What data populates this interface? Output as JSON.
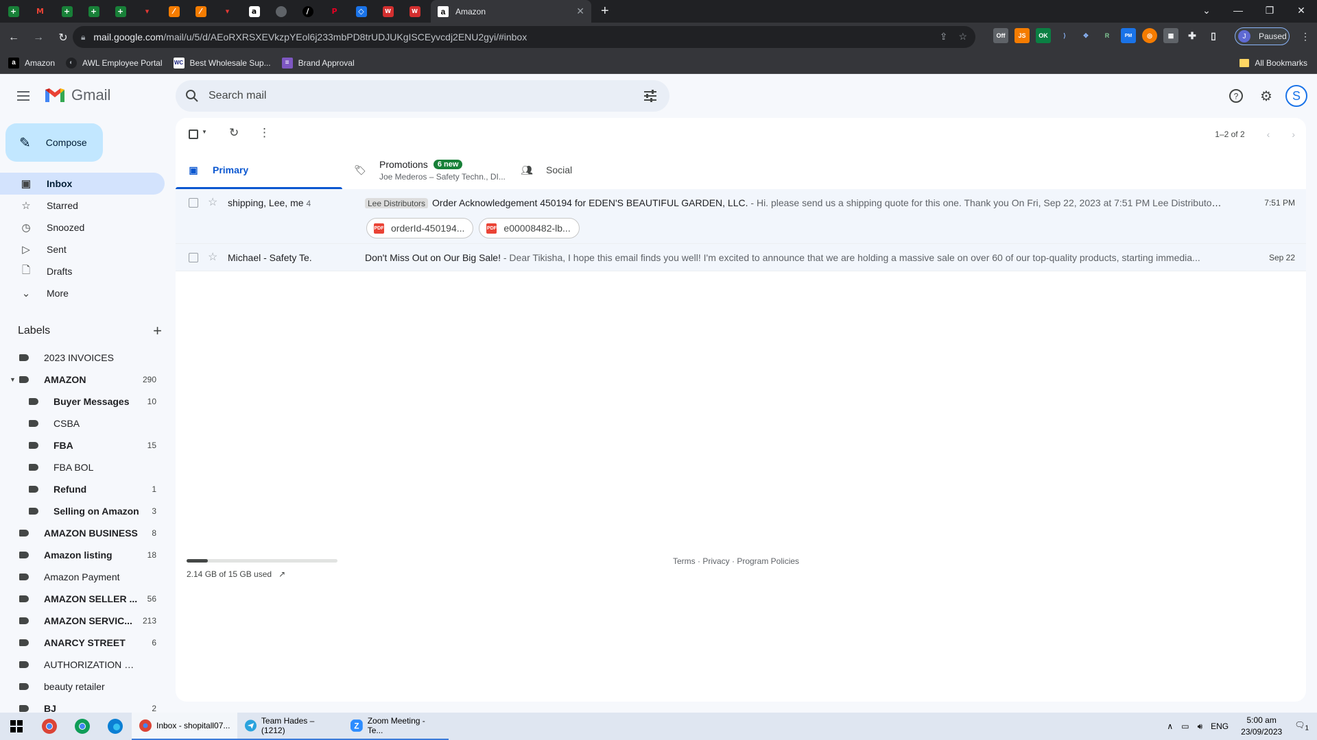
{
  "browser": {
    "active_tab_title": "Amazon",
    "url_host": "mail.google.com",
    "url_path": "/mail/u/5/d/AEoRXRSXEVkzpYEol6j233mbPD8trUDJUKgISCEyvcdj2ENU2gyi/#inbox",
    "profile_label": "Paused",
    "profile_initial": "J",
    "bookmarks": [
      "Amazon",
      "AWL Employee Portal",
      "Best Wholesale Sup...",
      "Brand Approval"
    ],
    "all_bookmarks": "All Bookmarks"
  },
  "gmail": {
    "logo_text": "Gmail",
    "search_placeholder": "Search mail",
    "avatar_initial": "S",
    "compose_label": "Compose",
    "nav": [
      {
        "label": "Inbox",
        "icon": "inbox-icon"
      },
      {
        "label": "Starred",
        "icon": "star-icon"
      },
      {
        "label": "Snoozed",
        "icon": "clock-icon"
      },
      {
        "label": "Sent",
        "icon": "send-icon"
      },
      {
        "label": "Drafts",
        "icon": "draft-icon"
      },
      {
        "label": "More",
        "icon": "chevron-down-icon"
      }
    ],
    "labels_title": "Labels",
    "labels": [
      {
        "name": "2023 INVOICES",
        "count": "",
        "bold": false,
        "indent": false
      },
      {
        "name": "AMAZON",
        "count": "290",
        "bold": true,
        "indent": false
      },
      {
        "name": "Buyer Messages",
        "count": "10",
        "bold": true,
        "indent": true
      },
      {
        "name": "CSBA",
        "count": "",
        "bold": false,
        "indent": true
      },
      {
        "name": "FBA",
        "count": "15",
        "bold": true,
        "indent": true
      },
      {
        "name": "FBA BOL",
        "count": "",
        "bold": false,
        "indent": true
      },
      {
        "name": "Refund",
        "count": "1",
        "bold": true,
        "indent": true
      },
      {
        "name": "Selling on Amazon",
        "count": "3",
        "bold": true,
        "indent": true
      },
      {
        "name": "AMAZON BUSINESS",
        "count": "8",
        "bold": true,
        "indent": false
      },
      {
        "name": "Amazon listing",
        "count": "18",
        "bold": true,
        "indent": false
      },
      {
        "name": "Amazon Payment",
        "count": "",
        "bold": false,
        "indent": false
      },
      {
        "name": "AMAZON SELLER ...",
        "count": "56",
        "bold": true,
        "indent": false
      },
      {
        "name": "AMAZON SERVIC...",
        "count": "213",
        "bold": true,
        "indent": false
      },
      {
        "name": "ANARCY STREET",
        "count": "6",
        "bold": true,
        "indent": false
      },
      {
        "name": "AUTHORIZATION REQU...",
        "count": "",
        "bold": false,
        "indent": false
      },
      {
        "name": "beauty retailer",
        "count": "",
        "bold": false,
        "indent": false
      },
      {
        "name": "BJ",
        "count": "2",
        "bold": true,
        "indent": false
      }
    ],
    "pager": "1–2 of 2",
    "tabs": {
      "primary": "Primary",
      "promotions": "Promotions",
      "promotions_badge": "6 new",
      "promotions_sub": "Joe Mederos – Safety Techn., DI...",
      "social": "Social"
    },
    "emails": [
      {
        "sender": "shipping, Lee, me",
        "count": "4",
        "label": "Lee Distributors",
        "subject": "Order Acknowledgement 450194 for EDEN'S BEAUTIFUL GARDEN, LLC.",
        "snippet": " - Hi. please send us a shipping quote for this one. Thank you On Fri, Sep 22, 2023 at 7:51 PM Lee Distributor...",
        "date": "7:51 PM",
        "attachments": [
          "orderId-450194...",
          "e00008482-lb..."
        ]
      },
      {
        "sender": "Michael - Safety Te.",
        "subject": "Don't Miss Out on Our Big Sale!",
        "snippet": " - Dear Tikisha, I hope this email finds you well! I'm excited to announce that we are holding a massive sale on over 60 of our top-quality products, starting immedia...",
        "date": "Sep 22"
      }
    ],
    "storage_text": "2.14 GB of 15 GB used",
    "storage_fraction": 0.143,
    "footer": "Terms · Privacy · Program Policies"
  },
  "taskbar": {
    "apps": [
      "Inbox - shopitall07...",
      "Team Hades – (1212)",
      "Zoom Meeting - Te..."
    ],
    "lang": "ENG",
    "time": "5:00 am",
    "date": "23/09/2023",
    "notif_count": "1"
  }
}
